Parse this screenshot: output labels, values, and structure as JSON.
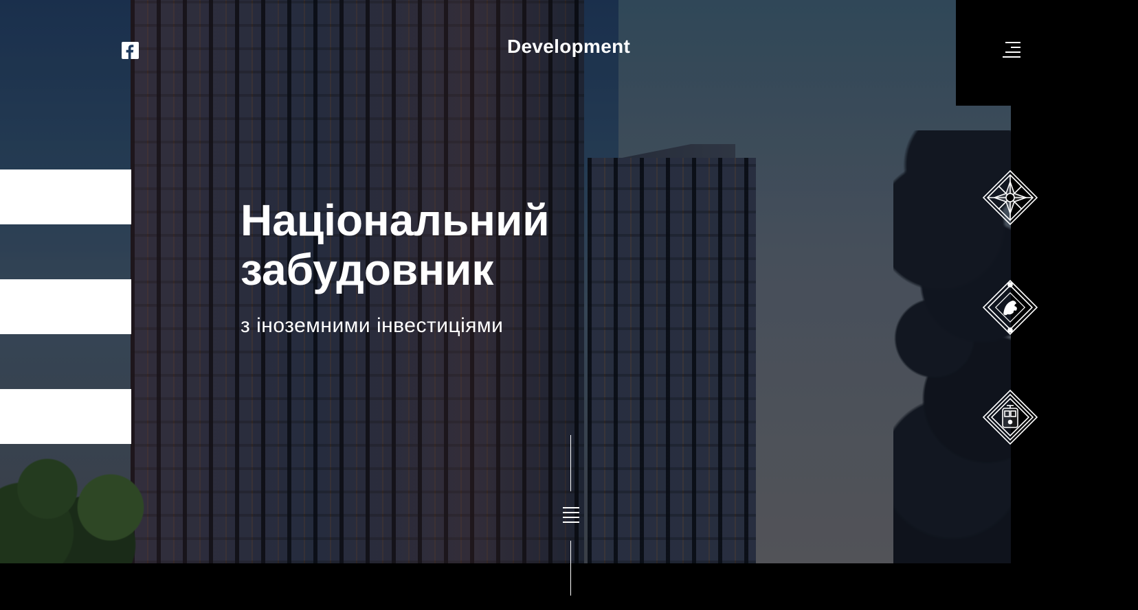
{
  "header": {
    "brand": "Development",
    "social_icon": "facebook-icon",
    "menu_icon": "hamburger-menu-icon"
  },
  "hero": {
    "title_line1": "Національний",
    "title_line2": "забудовник",
    "subtitle": "з іноземними інвестиціями",
    "scroll_icon": "scroll-down-icon"
  },
  "projects": [
    {
      "icon": "compass-star-emblem-icon"
    },
    {
      "icon": "lion-crest-emblem-icon"
    },
    {
      "icon": "tram-emblem-icon"
    }
  ],
  "colors": {
    "background": "#000000",
    "text": "#ffffff",
    "sky": "#1f3a5e"
  }
}
